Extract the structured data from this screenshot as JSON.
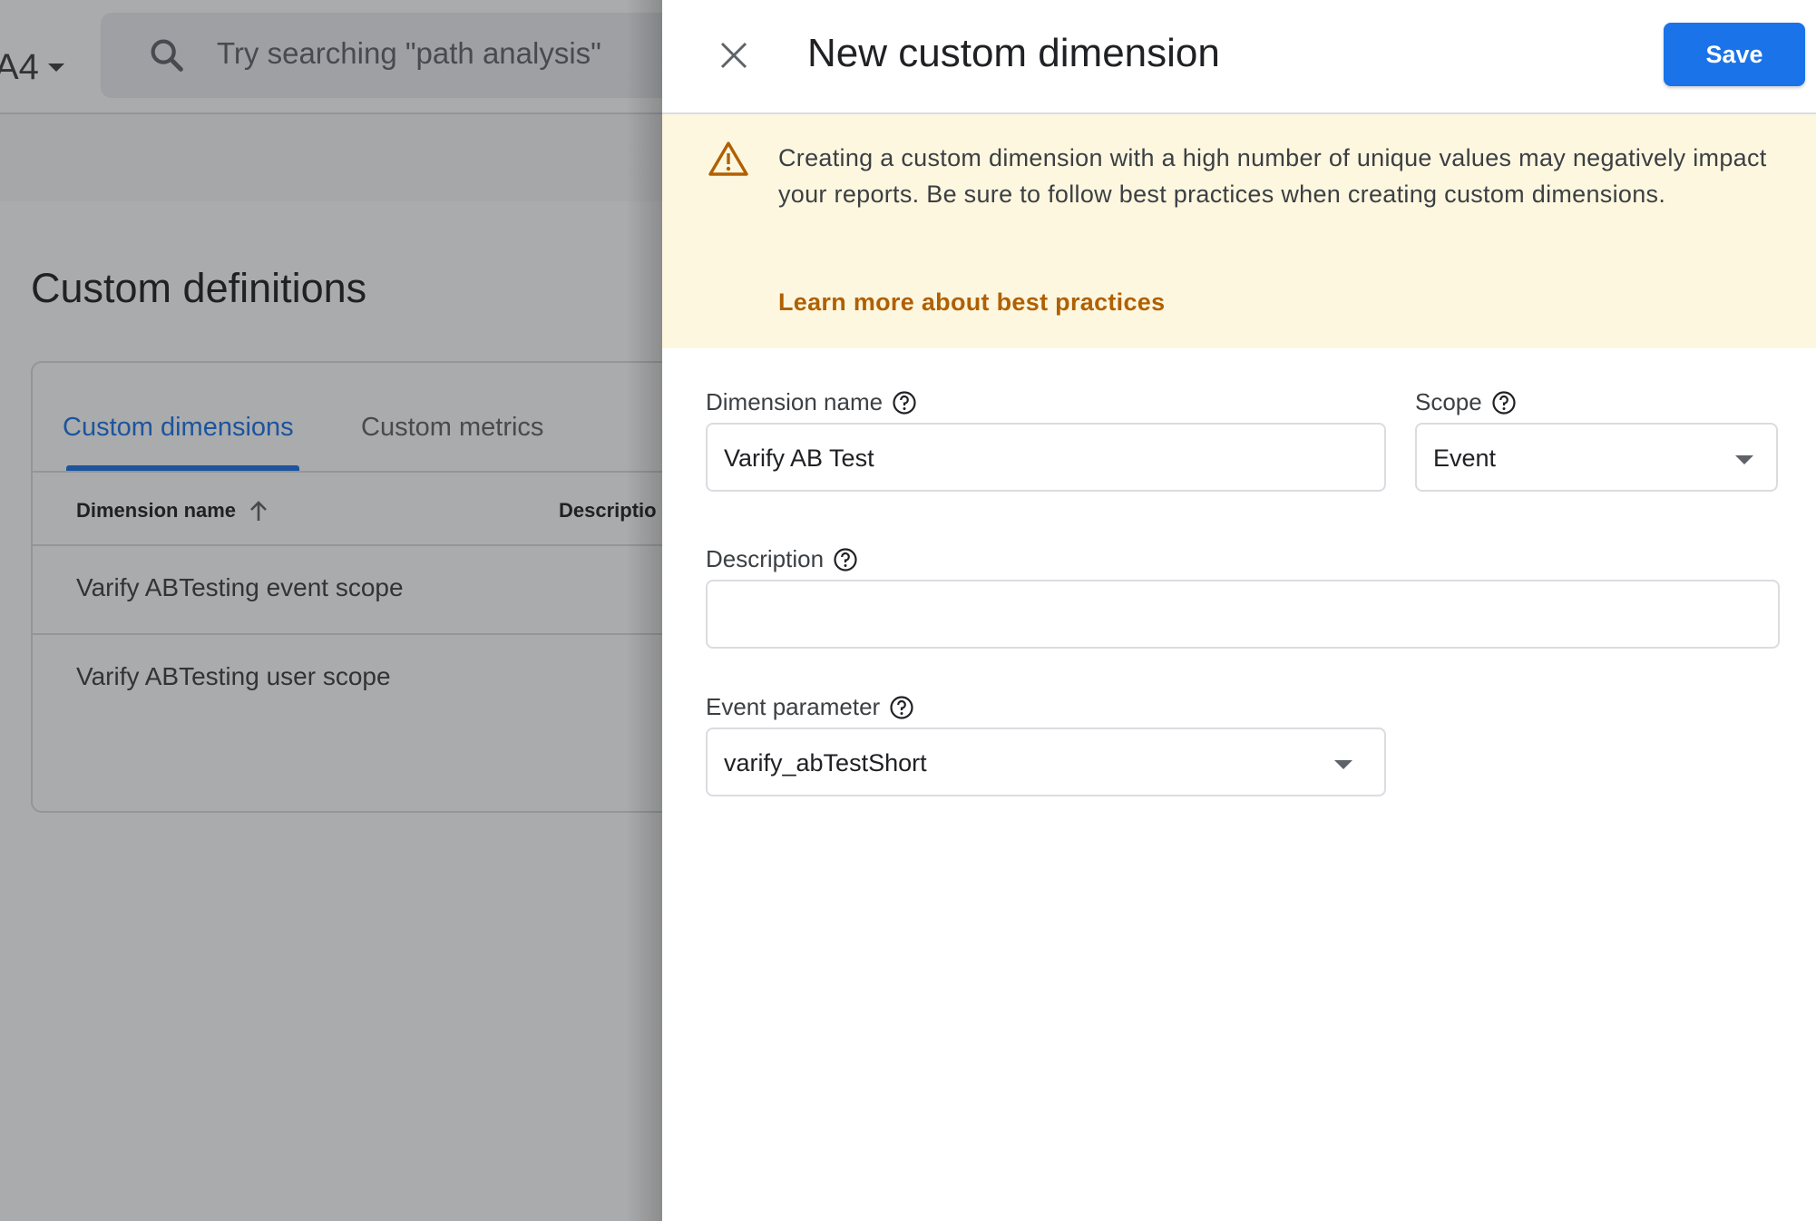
{
  "background": {
    "property_label": "A4",
    "search": {
      "placeholder": "Try searching \"path analysis\""
    },
    "page_title": "Custom definitions",
    "tabs": [
      {
        "label": "Custom dimensions",
        "active": true
      },
      {
        "label": "Custom metrics",
        "active": false
      }
    ],
    "table": {
      "columns": [
        "Dimension name",
        "Descriptio"
      ],
      "rows": [
        "Varify ABTesting event scope",
        "Varify ABTesting user scope"
      ]
    }
  },
  "panel": {
    "title": "New custom dimension",
    "save_label": "Save",
    "warning": {
      "text": "Creating a custom dimension with a high number of unique values may negatively impact your reports. Be sure to follow best practices when creating custom dimensions.",
      "link": "Learn more about best practices"
    },
    "dimension_name": {
      "label": "Dimension name",
      "value": "Varify AB Test"
    },
    "scope": {
      "label": "Scope",
      "value": "Event"
    },
    "description": {
      "label": "Description",
      "value": ""
    },
    "event_parameter": {
      "label": "Event parameter",
      "value": "varify_abTestShort"
    }
  },
  "colors": {
    "accent": "#1a73e8",
    "warning_bg": "#fef7e0",
    "warning_fg": "#b06000"
  }
}
